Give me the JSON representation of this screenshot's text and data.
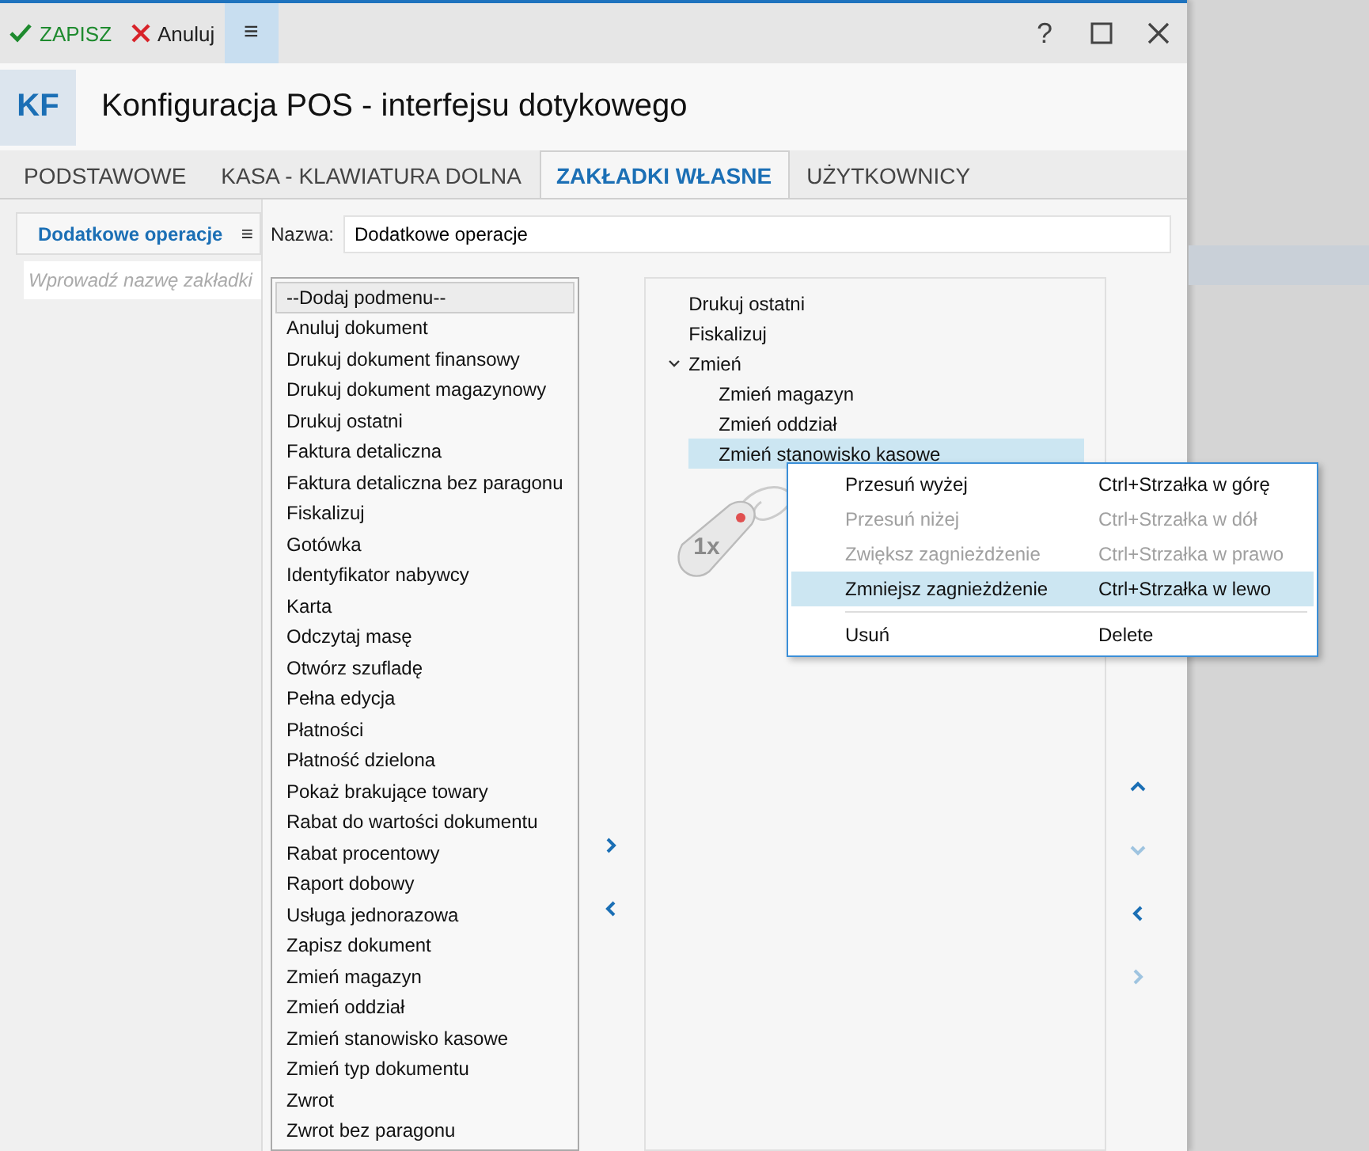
{
  "toolbar": {
    "save": "ZAPISZ",
    "cancel": "Anuluj",
    "menu": "≡",
    "help": "?"
  },
  "header": {
    "badge": "KF",
    "title": "Konfiguracja POS - interfejsu dotykowego"
  },
  "tabs": [
    {
      "label": "PODSTAWOWE",
      "selected": false
    },
    {
      "label": "KASA - KLAWIATURA DOLNA",
      "selected": false
    },
    {
      "label": "ZAKŁADKI WŁASNE",
      "selected": true
    },
    {
      "label": "UŻYTKOWNICY",
      "selected": false
    }
  ],
  "side": {
    "tab": "Dodatkowe operacje",
    "menu": "≡",
    "search_placeholder": "Wprowadź nazwę zakładki"
  },
  "name_field": {
    "label": "Nazwa:",
    "value": "Dodatkowe operacje"
  },
  "operations": [
    {
      "label": "--Dodaj podmenu--",
      "selected": true
    },
    {
      "label": "Anuluj dokument",
      "selected": false
    },
    {
      "label": "Drukuj dokument finansowy",
      "selected": false
    },
    {
      "label": "Drukuj dokument magazynowy",
      "selected": false
    },
    {
      "label": "Drukuj ostatni",
      "selected": false
    },
    {
      "label": "Faktura detaliczna",
      "selected": false
    },
    {
      "label": "Faktura detaliczna bez paragonu",
      "selected": false
    },
    {
      "label": "Fiskalizuj",
      "selected": false
    },
    {
      "label": "Gotówka",
      "selected": false
    },
    {
      "label": "Identyfikator nabywcy",
      "selected": false
    },
    {
      "label": "Karta",
      "selected": false
    },
    {
      "label": "Odczytaj masę",
      "selected": false
    },
    {
      "label": "Otwórz szufladę",
      "selected": false
    },
    {
      "label": "Pełna edycja",
      "selected": false
    },
    {
      "label": "Płatności",
      "selected": false
    },
    {
      "label": "Płatność dzielona",
      "selected": false
    },
    {
      "label": "Pokaż brakujące towary",
      "selected": false
    },
    {
      "label": "Rabat do wartości dokumentu",
      "selected": false
    },
    {
      "label": "Rabat procentowy",
      "selected": false
    },
    {
      "label": "Raport dobowy",
      "selected": false
    },
    {
      "label": "Usługa jednorazowa",
      "selected": false
    },
    {
      "label": "Zapisz dokument",
      "selected": false
    },
    {
      "label": "Zmień magazyn",
      "selected": false
    },
    {
      "label": "Zmień oddział",
      "selected": false
    },
    {
      "label": "Zmień stanowisko kasowe",
      "selected": false
    },
    {
      "label": "Zmień typ dokumentu",
      "selected": false
    },
    {
      "label": "Zwrot",
      "selected": false
    },
    {
      "label": "Zwrot bez paragonu",
      "selected": false
    }
  ],
  "move_buttons": [
    {
      "kind": "right",
      "disabled": false
    },
    {
      "kind": "left",
      "disabled": false
    }
  ],
  "tree": [
    {
      "label": "Drukuj ostatni",
      "selected": false
    },
    {
      "label": "Fiskalizuj",
      "selected": false
    },
    {
      "label": "Zmień",
      "selected": false,
      "expanded": true,
      "children": [
        {
          "label": "Zmień magazyn",
          "selected": false
        },
        {
          "label": "Zmień oddział",
          "selected": false
        },
        {
          "label": "Zmień stanowisko kasowe",
          "selected": true
        }
      ]
    }
  ],
  "hint_badge": "1x",
  "order_buttons": [
    {
      "kind": "up",
      "disabled": false
    },
    {
      "kind": "down",
      "disabled": true
    },
    {
      "kind": "left",
      "disabled": false
    },
    {
      "kind": "right",
      "disabled": true
    }
  ],
  "context_menu": [
    {
      "kind": "item",
      "label": "Przesuń wyżej",
      "shortcut": "Ctrl+Strzałka w górę",
      "disabled": false,
      "selected": false
    },
    {
      "kind": "item",
      "label": "Przesuń niżej",
      "shortcut": "Ctrl+Strzałka w dół",
      "disabled": true,
      "selected": false
    },
    {
      "kind": "item",
      "label": "Zwiększ zagnieżdżenie",
      "shortcut": "Ctrl+Strzałka w prawo",
      "disabled": true,
      "selected": false
    },
    {
      "kind": "item",
      "label": "Zmniejsz zagnieżdżenie",
      "shortcut": "Ctrl+Strzałka w lewo",
      "disabled": false,
      "selected": true
    },
    {
      "kind": "separator"
    },
    {
      "kind": "item",
      "label": "Usuń",
      "shortcut": "Delete",
      "disabled": false,
      "selected": false
    }
  ]
}
